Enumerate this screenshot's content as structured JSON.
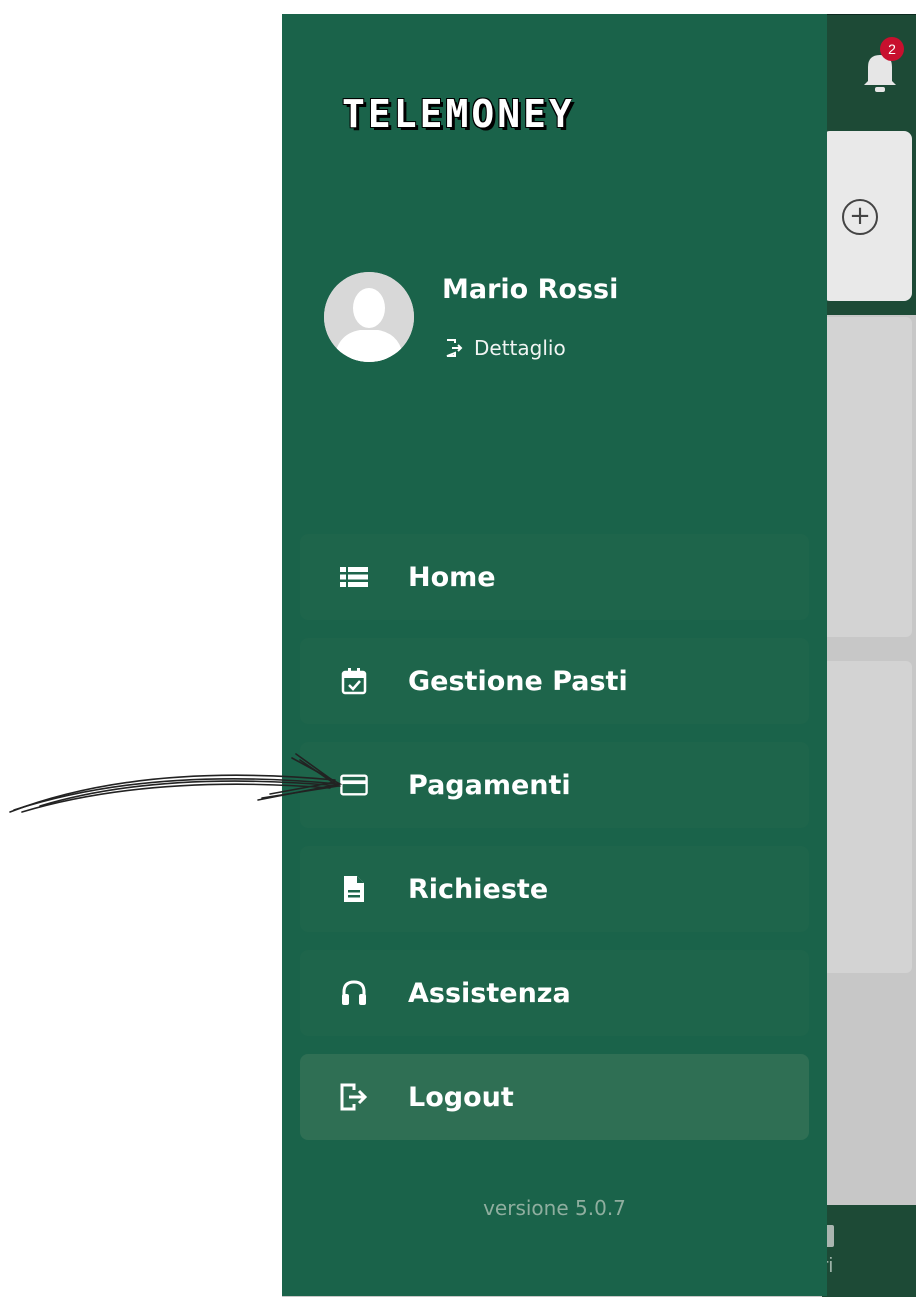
{
  "app": {
    "notification_count": "2",
    "bottom_nav_label": "ri",
    "plus_symbol": "+"
  },
  "drawer": {
    "brand": "TELEMONEY",
    "user": {
      "name": "Mario Rossi",
      "detail_label": "Dettaglio"
    },
    "menu": [
      {
        "label": "Home",
        "icon": "list-icon"
      },
      {
        "label": "Gestione Pasti",
        "icon": "calendar-check-icon"
      },
      {
        "label": "Pagamenti",
        "icon": "credit-card-icon"
      },
      {
        "label": "Richieste",
        "icon": "document-icon"
      },
      {
        "label": "Assistenza",
        "icon": "headset-icon"
      },
      {
        "label": "Logout",
        "icon": "logout-icon"
      }
    ],
    "version": "versione 5.0.7"
  },
  "colors": {
    "drawer_bg": "#1a634a",
    "active_item_bg": "#2f6f54",
    "badge": "#c8102e",
    "app_header": "#1d4a36"
  }
}
